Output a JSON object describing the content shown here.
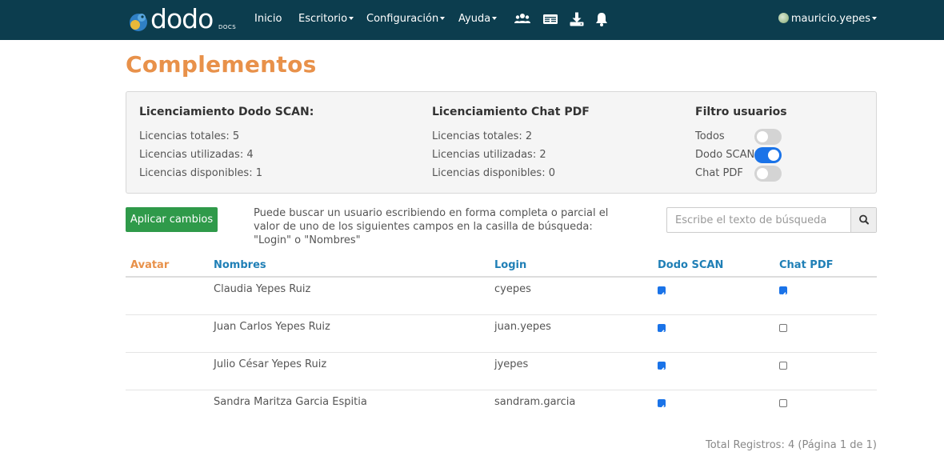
{
  "brand": {
    "name": "dodo",
    "sub": "DOCS"
  },
  "nav": {
    "items": [
      {
        "label": "Inicio"
      },
      {
        "label": "Escritorio"
      },
      {
        "label": "Configuración"
      },
      {
        "label": "Ayuda"
      }
    ],
    "icons": [
      "users-icon",
      "id-card-icon",
      "download-icon",
      "bell-icon"
    ],
    "user": "mauricio.yepes"
  },
  "page": {
    "title": "Complementos"
  },
  "licenses": {
    "scan": {
      "title": "Licenciamiento Dodo SCAN:",
      "total": "Licencias totales: 5",
      "used": "Licencias utilizadas: 4",
      "available": "Licencias disponibles: 1"
    },
    "pdf": {
      "title": "Licenciamiento Chat PDF",
      "total": "Licencias totales: 2",
      "used": "Licencias utilizadas: 2",
      "available": "Licencias disponibles: 0"
    },
    "filter": {
      "title": "Filtro usuarios",
      "options": [
        {
          "label": "Todos",
          "on": false
        },
        {
          "label": "Dodo SCAN",
          "on": true
        },
        {
          "label": "Chat PDF",
          "on": false
        }
      ]
    }
  },
  "actions": {
    "apply_label": "Aplicar cambios",
    "help_text": "Puede buscar un usuario escribiendo en forma completa o parcial el valor de uno de los siguientes campos en la casilla de búsqueda: \"Login\" o \"Nombres\"",
    "search_placeholder": "Escribe el texto de búsqueda"
  },
  "table": {
    "headers": {
      "avatar": "Avatar",
      "name": "Nombres",
      "login": "Login",
      "scan": "Dodo SCAN",
      "pdf": "Chat PDF"
    },
    "rows": [
      {
        "name": "Claudia Yepes Ruiz",
        "login": "cyepes",
        "scan": true,
        "pdf": true
      },
      {
        "name": "Juan Carlos Yepes Ruiz",
        "login": "juan.yepes",
        "scan": true,
        "pdf": false
      },
      {
        "name": "Julio César Yepes Ruiz",
        "login": "jyepes",
        "scan": true,
        "pdf": false
      },
      {
        "name": "Sandra Maritza Garcia Espitia",
        "login": "sandram.garcia",
        "scan": true,
        "pdf": false
      }
    ]
  },
  "footer": {
    "summary": "Total Registros: 4 (Página 1 de 1)"
  },
  "colors": {
    "navbar": "#0c3d4e",
    "title": "#e8914a",
    "header_link": "#1f7fb6",
    "apply_button": "#2f9a4a",
    "toggle_on": "#1a73e8"
  }
}
